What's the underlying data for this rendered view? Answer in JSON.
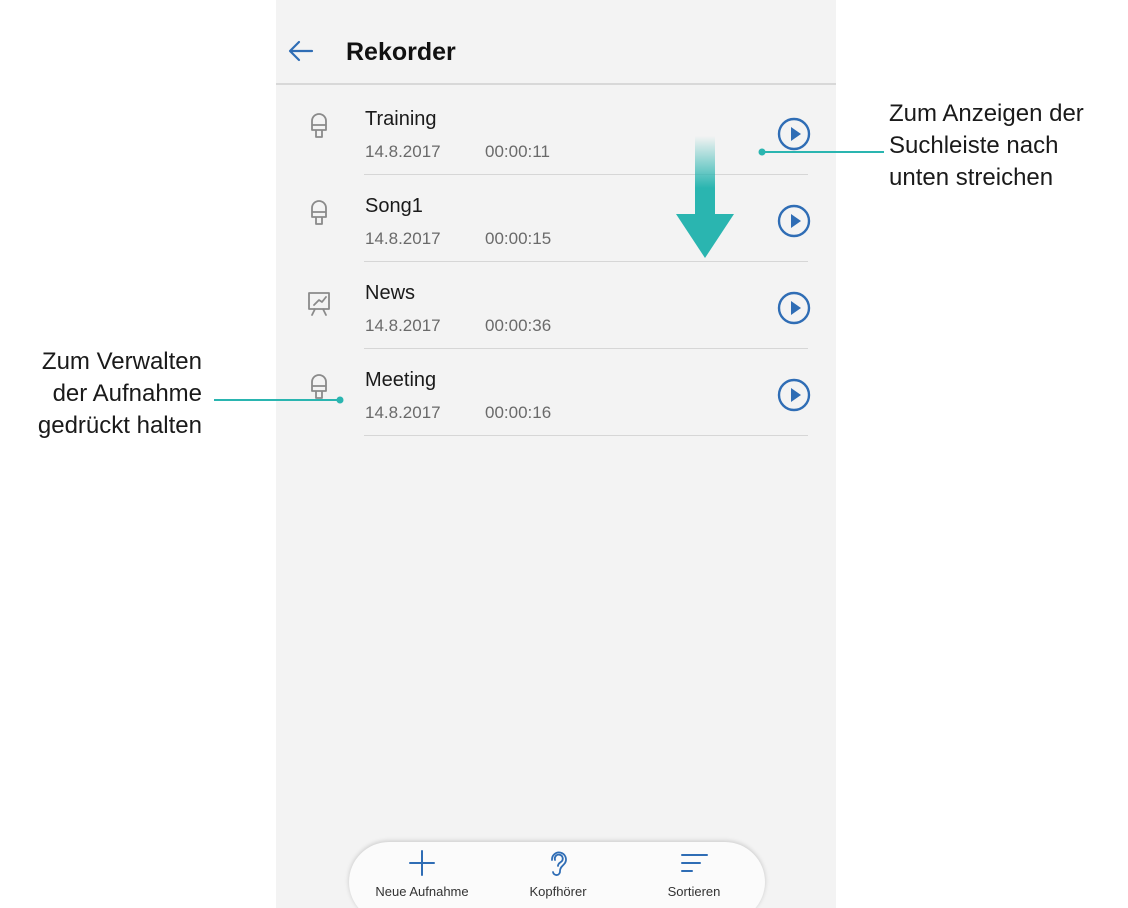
{
  "header": {
    "title": "Rekorder",
    "back_icon": "arrow-left-icon"
  },
  "recordings": [
    {
      "name": "Training",
      "date": "14.8.2017",
      "duration": "00:00:11",
      "icon": "microphone-icon"
    },
    {
      "name": "Song1",
      "date": "14.8.2017",
      "duration": "00:00:15",
      "icon": "microphone-icon"
    },
    {
      "name": "News",
      "date": "14.8.2017",
      "duration": "00:00:36",
      "icon": "presentation-icon"
    },
    {
      "name": "Meeting",
      "date": "14.8.2017",
      "duration": "00:00:16",
      "icon": "microphone-icon"
    }
  ],
  "bottom_bar": {
    "new_recording": "Neue Aufnahme",
    "headphones": "Kopfhörer",
    "sort": "Sortieren"
  },
  "annotations": {
    "left": [
      "Zum Verwalten",
      "der Aufnahme",
      "gedrückt halten"
    ],
    "right": [
      "Zum Anzeigen der",
      "Suchleiste nach",
      "unten streichen"
    ]
  },
  "colors": {
    "accent_blue": "#2f6db5",
    "callout_teal": "#2ab5b0",
    "background": "#f3f3f3",
    "icon_gray": "#8a8a8a"
  }
}
